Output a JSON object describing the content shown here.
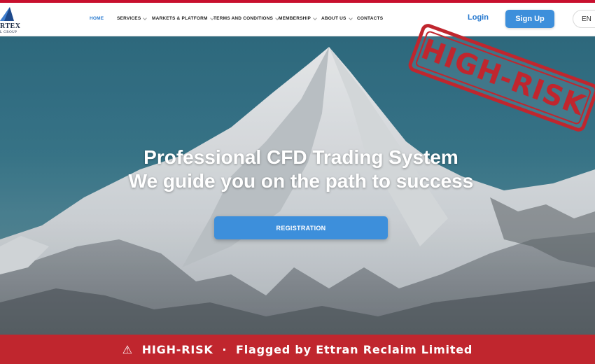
{
  "logo": {
    "word": "RTEX",
    "sub": "L GROUP"
  },
  "nav": {
    "items": [
      {
        "label": "HOME",
        "active": true,
        "dropdown": false
      },
      {
        "label": "SERVICES",
        "active": false,
        "dropdown": true
      },
      {
        "label": "MARKETS & PLATFORM",
        "active": false,
        "dropdown": true
      },
      {
        "label": "TERMS AND CONDITIONS",
        "active": false,
        "dropdown": true
      },
      {
        "label": "MEMBERSHIP",
        "active": false,
        "dropdown": true
      },
      {
        "label": "ABOUT US",
        "active": false,
        "dropdown": true
      },
      {
        "label": "CONTACTS",
        "active": false,
        "dropdown": false
      }
    ]
  },
  "header": {
    "login_label": "Login",
    "signup_label": "Sign Up",
    "language": "EN"
  },
  "hero": {
    "headline_line1": "Professional CFD Trading System",
    "headline_line2": "We guide you on the path to success",
    "cta_label": "REGISTRATION"
  },
  "stamp": {
    "text": "HIGH-RISK"
  },
  "banner": {
    "icon": "warning-icon",
    "icon_glyph": "⚠",
    "label": "HIGH-RISK",
    "separator": "·",
    "message": "Flagged by Ettran Reclaim Limited"
  },
  "colors": {
    "accent": "#3d8fdb",
    "active_nav": "#2a7bd0",
    "warning": "#c0262e"
  }
}
